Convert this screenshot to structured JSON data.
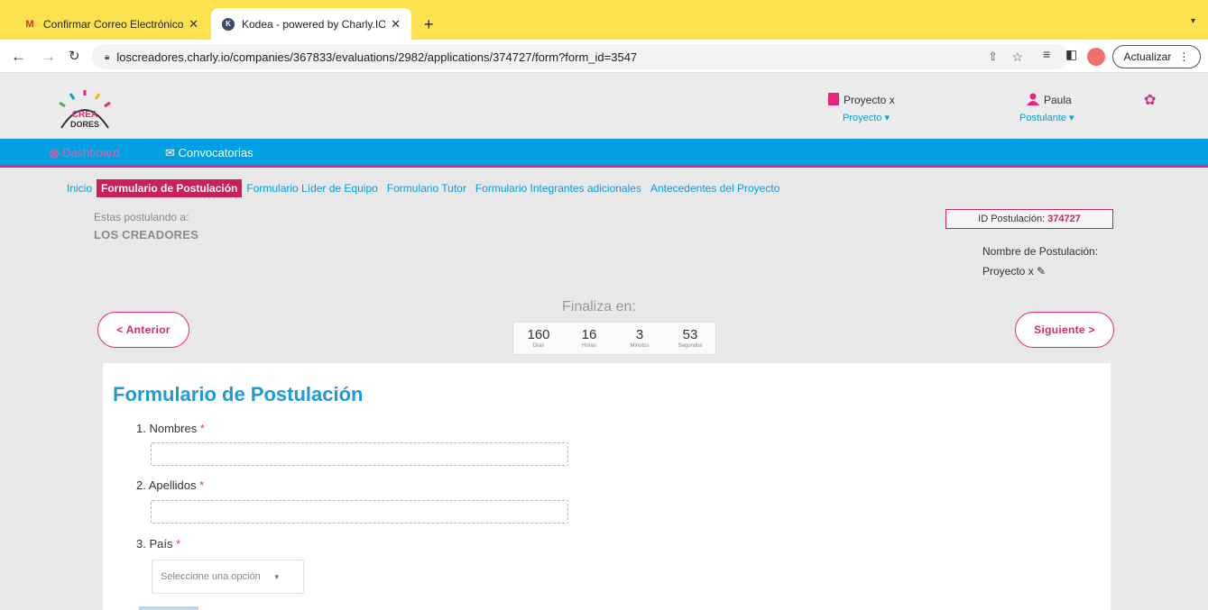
{
  "browser": {
    "tabs": [
      {
        "title": "Confirmar Correo Electrónico -",
        "favicon": "gmail-icon",
        "active": false
      },
      {
        "title": "Kodea - powered by Charly.IO",
        "favicon": "kodea-icon",
        "active": true
      }
    ],
    "new_tab": "+",
    "url": "loscreadores.charly.io/companies/367833/evaluations/2982/applications/374727/form?form_id=3547",
    "update_button": "Actualizar"
  },
  "header": {
    "logo_text": "CREA DORES",
    "project_name": "Proyecto x",
    "project_menu": "Proyecto",
    "user_name": "Paula",
    "user_role": "Postulante",
    "colors": {
      "brand_pink": "#e8247e",
      "brand_blue": "#00a0e3"
    }
  },
  "nav": {
    "dashboard": "Dashboard",
    "convocatorias": "Convocatorias"
  },
  "steps": [
    "Inicio",
    "Formulario de Postulación",
    "Formulario Líder de Equipo",
    "Formulario Tutor",
    "Formulario Integrantes adicionales",
    "Antecedentes del Proyecto"
  ],
  "applying": {
    "label": "Estas postulando a:",
    "name": "LOS CREADORES"
  },
  "application": {
    "id_label": "ID Postulación:",
    "id_value": "374727",
    "name_label": "Nombre de Postulación:",
    "name_value": "Proyecto x"
  },
  "countdown": {
    "label": "Finaliza en:",
    "days": "160",
    "days_label": "Días",
    "hours": "16",
    "hours_label": "Horas",
    "minutes": "3",
    "minutes_label": "Minutos",
    "seconds": "53",
    "seconds_label": "Segundos"
  },
  "pager": {
    "prev": "< Anterior",
    "next": "Siguiente >"
  },
  "form": {
    "title": "Formulario de Postulación",
    "questions": [
      {
        "label": "1. Nombres",
        "required": "*",
        "value": ""
      },
      {
        "label": "2. Apellidos",
        "required": "*",
        "value": ""
      },
      {
        "label": "3. País",
        "required": "*",
        "placeholder": "Seleccione una opción"
      }
    ]
  }
}
